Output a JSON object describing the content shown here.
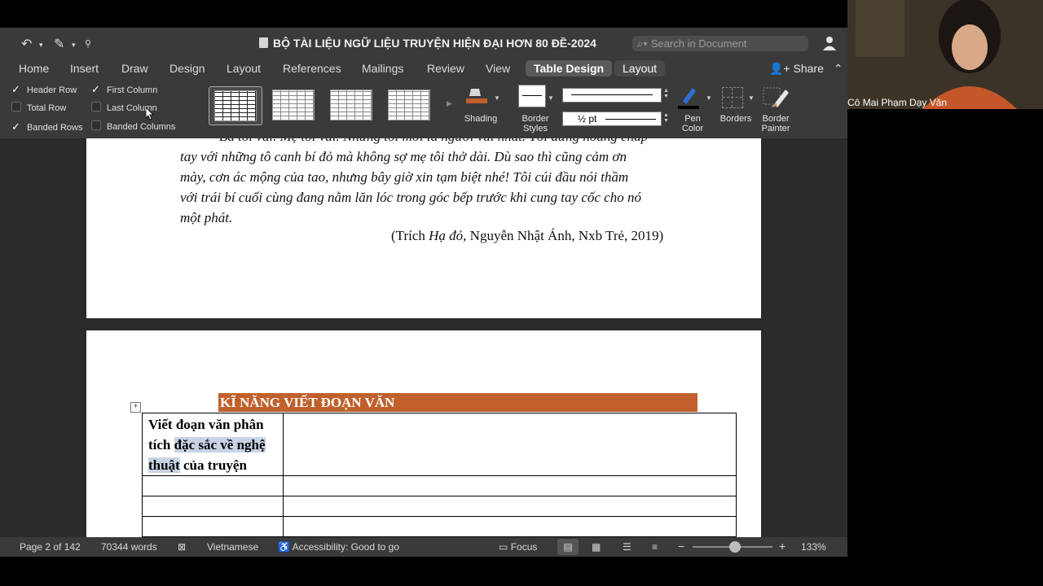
{
  "window": {
    "title": "BỘ TÀI LIỆU NGỮ LIỆU TRUYỆN HIỆN ĐẠI HƠN 80 ĐỀ-2024",
    "search_placeholder": "Search in Document"
  },
  "tabs": [
    "Home",
    "Insert",
    "Draw",
    "Design",
    "Layout",
    "References",
    "Mailings",
    "Review",
    "View",
    "Table Design",
    "Layout"
  ],
  "active_tab": "Table Design",
  "share_label": "Share",
  "ribbon": {
    "options": [
      {
        "label": "Header Row",
        "checked": true
      },
      {
        "label": "First Column",
        "checked": true
      },
      {
        "label": "Total Row",
        "checked": false
      },
      {
        "label": "Last Column",
        "checked": false
      },
      {
        "label": "Banded Rows",
        "checked": true
      },
      {
        "label": "Banded Columns",
        "checked": false
      }
    ],
    "shading_label": "Shading",
    "border_styles_label": [
      "Border",
      "Styles"
    ],
    "line_weight": "½ pt",
    "pen_color_label": [
      "Pen",
      "Color"
    ],
    "borders_label": "Borders",
    "border_painter_label": [
      "Border",
      "Painter"
    ],
    "accent_color": "#c0602c"
  },
  "page1": {
    "lines": [
      "Bà tôi vái. Mẹ tôi vái. Nhưng tôi mới là người vái nhất. Tôi đứng hoàng chắp",
      "tay với những tô canh bí đỏ mà không sợ mẹ tôi thở dài. Dù sao thì cũng cảm ơn",
      "mày, cơn ác mộng của tao, nhưng bây giờ xin tạm biệt nhé! Tôi cúi đầu nói thầm",
      "với trái bí cuối cùng đang nằm lăn lóc trong góc bếp trước khi cung tay cốc cho nó",
      "một phát."
    ],
    "citation_prefix": "(Trích ",
    "citation_title": "Hạ đỏ",
    "citation_suffix": ", Nguyễn Nhật Ánh, Nxb Trẻ, 2019)"
  },
  "page2": {
    "heading": "KĨ NĂNG VIẾT ĐOẠN VĂN",
    "table_add_handle": "+",
    "cell": {
      "part1": "Viết đoạn văn phân tích ",
      "highlight1": "đặc sắc về nghệ",
      "highlight2": "thuật",
      "part3": " của truyện"
    }
  },
  "status": {
    "page": "Page 2 of 142",
    "words": "70344 words",
    "language": "Vietnamese",
    "accessibility": "Accessibility: Good to go",
    "focus": "Focus",
    "zoom": "133%",
    "zoom_minus": "−",
    "zoom_plus": "+"
  },
  "video": {
    "name": "Cô Mai Phạm Dạy Văn"
  }
}
